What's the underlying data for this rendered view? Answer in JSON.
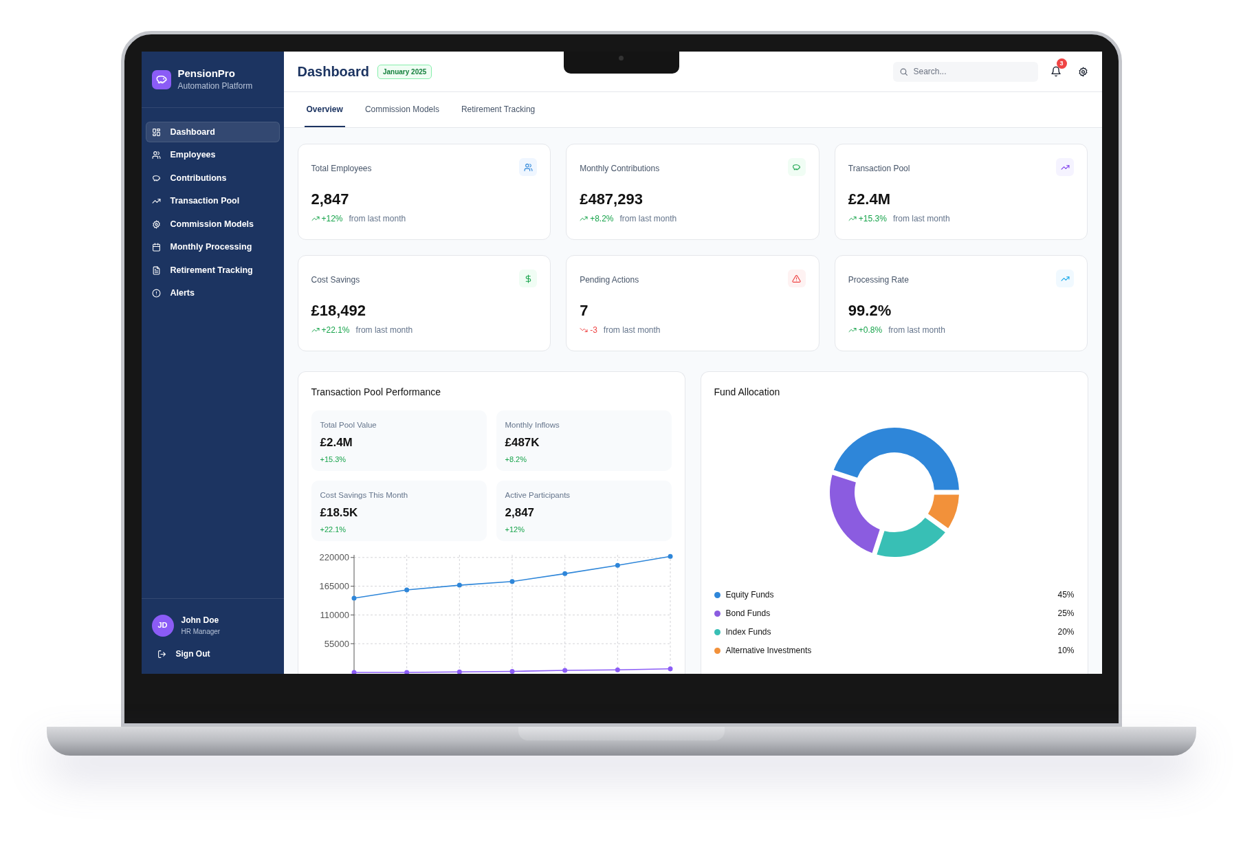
{
  "app": {
    "name": "PensionPro",
    "subtitle": "Automation Platform"
  },
  "sidebar": {
    "items": [
      {
        "label": "Dashboard",
        "selected": true
      },
      {
        "label": "Employees",
        "selected": false
      },
      {
        "label": "Contributions",
        "selected": false
      },
      {
        "label": "Transaction Pool",
        "selected": false
      },
      {
        "label": "Commission Models",
        "selected": false
      },
      {
        "label": "Monthly Processing",
        "selected": false
      },
      {
        "label": "Retirement Tracking",
        "selected": false
      },
      {
        "label": "Alerts",
        "selected": false
      }
    ]
  },
  "user": {
    "initials": "JD",
    "name": "John Doe",
    "role": "HR Manager",
    "sign_out": "Sign Out"
  },
  "header": {
    "title": "Dashboard",
    "period": "January 2025",
    "search": {
      "placeholder": "Search..."
    },
    "notifications": "3"
  },
  "tabs": [
    {
      "label": "Overview",
      "selected": true
    },
    {
      "label": "Commission Models",
      "selected": false
    },
    {
      "label": "Retirement Tracking",
      "selected": false
    }
  ],
  "stats": [
    {
      "label": "Total Employees",
      "value": "2,847",
      "change": "+12%",
      "note": "from last month",
      "negative": false
    },
    {
      "label": "Monthly Contributions",
      "value": "£487,293",
      "change": "+8.2%",
      "note": "from last month",
      "negative": false
    },
    {
      "label": "Transaction Pool",
      "value": "£2.4M",
      "change": "+15.3%",
      "note": "from last month",
      "negative": false
    },
    {
      "label": "Cost Savings",
      "value": "£18,492",
      "change": "+22.1%",
      "note": "from last month",
      "negative": false
    },
    {
      "label": "Pending Actions",
      "value": "7",
      "change": "-3",
      "note": "from last month",
      "negative": true
    },
    {
      "label": "Processing Rate",
      "value": "99.2%",
      "change": "+0.8%",
      "note": "from last month",
      "negative": false
    }
  ],
  "pool_performance": {
    "title": "Transaction Pool Performance",
    "metrics": [
      {
        "label": "Total Pool Value",
        "value": "£2.4M",
        "change": "+15.3%"
      },
      {
        "label": "Monthly Inflows",
        "value": "£487K",
        "change": "+8.2%"
      },
      {
        "label": "Cost Savings This Month",
        "value": "£18.5K",
        "change": "+22.1%"
      },
      {
        "label": "Active Participants",
        "value": "2,847",
        "change": "+12%"
      }
    ],
    "chart_data": {
      "type": "line",
      "ylim": [
        0,
        225000
      ],
      "yticks": [
        55000,
        110000,
        165000,
        220000
      ],
      "grid": true,
      "series": [
        {
          "color": "#2e86d9",
          "marker": "circle",
          "values": [
            142000,
            158000,
            167000,
            174000,
            189000,
            205000,
            222000
          ]
        },
        {
          "color": "#8b5cf6",
          "marker": "circle",
          "values": [
            0,
            0,
            1000,
            2000,
            4000,
            5000,
            7000
          ]
        }
      ]
    }
  },
  "fund_allocation": {
    "title": "Fund Allocation",
    "chart_data": {
      "type": "donut",
      "categories": [
        "Equity Funds",
        "Bond Funds",
        "Index Funds",
        "Alternative Investments"
      ],
      "values": [
        45,
        25,
        20,
        10
      ]
    },
    "legend": [
      {
        "value": "45%",
        "color": "#2e86d9"
      },
      {
        "value": "25%",
        "color": "#8b5ce0"
      },
      {
        "value": "20%",
        "color": "#38bfb5"
      },
      {
        "value": "10%",
        "color": "#f2913a"
      }
    ]
  }
}
